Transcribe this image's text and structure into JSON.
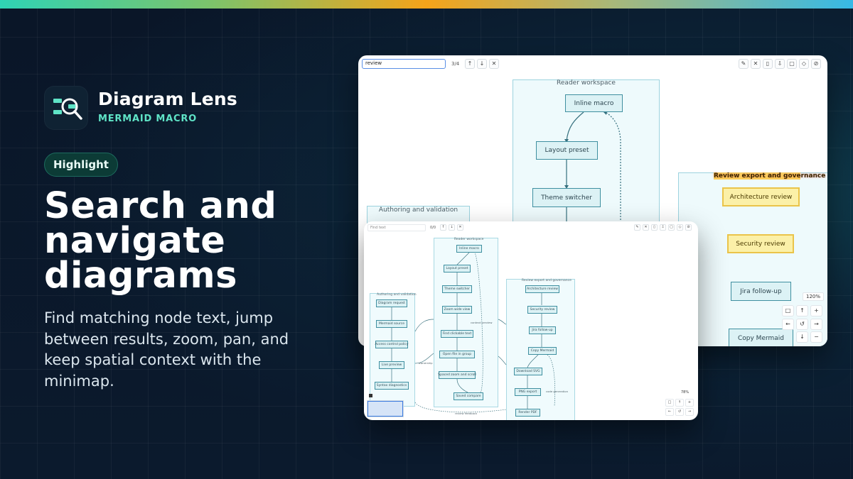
{
  "brand": {
    "title": "Diagram Lens",
    "subtitle": "MERMAID MACRO",
    "accent": "#5fe3c6"
  },
  "hero": {
    "pill": "Highlight",
    "headline": "Search and navigate diagrams",
    "description": "Find matching node text, jump between results, zoom, pan, and keep spatial context with the minimap."
  },
  "window_main": {
    "search": {
      "value": "review",
      "counter": "3/4"
    },
    "search_buttons": [
      "↑",
      "↓",
      "✕"
    ],
    "toolbar_icons": [
      "pencil-icon",
      "close-icon",
      "copy-icon",
      "download-icon",
      "frame-icon",
      "palette-icon",
      "settings-icon"
    ],
    "zoom": "120%",
    "clusters": {
      "reader": "Reader workspace",
      "authoring": "Authoring and validation",
      "review": "Review export and governance"
    },
    "nodes": {
      "inline_macro": "Inline macro",
      "layout_preset": "Layout preset",
      "theme_switcher": "Theme switcher",
      "architecture_review": "Architecture review",
      "security_review": "Security review",
      "jira_followup": "Jira follow-up",
      "copy_mermaid": "Copy Mermaid"
    },
    "controls": [
      "□",
      "↑",
      "+",
      "←",
      "↺",
      "→",
      "↓",
      "−"
    ]
  },
  "window_small": {
    "search": {
      "placeholder": "Find text",
      "counter": "0/0"
    },
    "search_buttons": [
      "↑",
      "↓",
      "✕"
    ],
    "zoom": "78%",
    "clusters": {
      "reader": "Reader workspace",
      "authoring": "Authoring and validation",
      "review": "Review export and governance"
    },
    "nodes": {
      "inline_macro": "Inline macro",
      "layout_preset": "Layout preset",
      "theme_switcher": "Theme switcher",
      "zoom_wide": "Zoom wide view",
      "find_clickable": "Find clickable text",
      "open_all_in_group": "Open file in group",
      "spaced_review": "Spaced zoom and scroll",
      "saved_compare": "Saved compare",
      "diagram_request": "Diagram request",
      "mermaid_source": "Mermaid source",
      "access_policy": "Access control policy",
      "live_preview": "Live preview",
      "syntax_diagnostics": "Syntax diagnostics",
      "architecture_review": "Architecture review",
      "security_review": "Security review",
      "jira_followup": "Jira follow-up",
      "copy_mermaid": "Copy Mermaid",
      "download_svg": "Download SVG",
      "pdf_export": "PNG export",
      "render_pdf": "Render PDF"
    },
    "edge_labels": {
      "context_preview": "context preview",
      "ownership": "ownership",
      "review_feedback": "review feedback",
      "code_generation": "code generation"
    },
    "controls": [
      "□",
      "↑",
      "+",
      "←",
      "↺",
      "→"
    ]
  }
}
